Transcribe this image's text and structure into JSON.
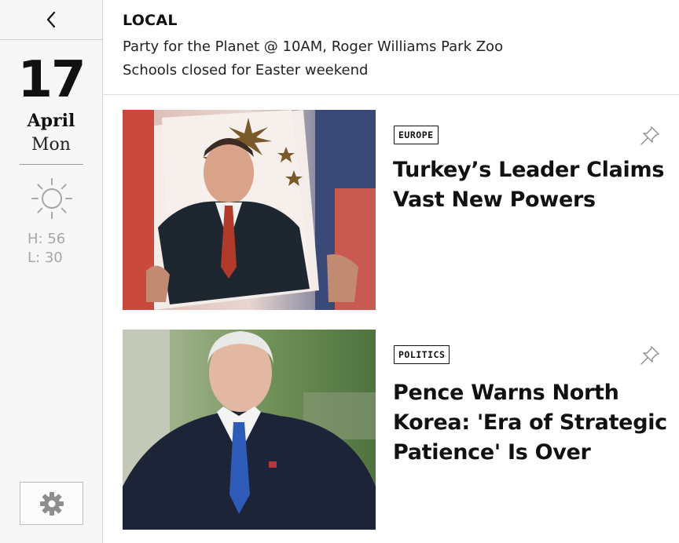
{
  "sidebar": {
    "back_icon": "chevron-left-icon",
    "date": {
      "day": "17",
      "month": "April",
      "weekday": "Mon"
    },
    "weather": {
      "icon": "sun-icon",
      "high": "H: 56",
      "low": "L:  30"
    },
    "settings_icon": "gear-icon"
  },
  "local": {
    "heading": "LOCAL",
    "items": [
      "Party for the Planet @ 10AM, Roger Williams Park Zoo",
      "Schools closed for Easter weekend"
    ]
  },
  "articles": [
    {
      "section": "EUROPE",
      "headline": "Turkey’s Leader Claims Vast New Powers",
      "pin_icon": "pin-icon"
    },
    {
      "section": "POLITICS",
      "headline": "Pence Warns North Korea: 'Era of Strategic Patience' Is Over",
      "pin_icon": "pin-icon"
    }
  ],
  "colors": {
    "accent": "#111111",
    "muted": "#a7a7a7",
    "sidebar_bg": "#f7f7f7",
    "divider": "#dddddd"
  }
}
